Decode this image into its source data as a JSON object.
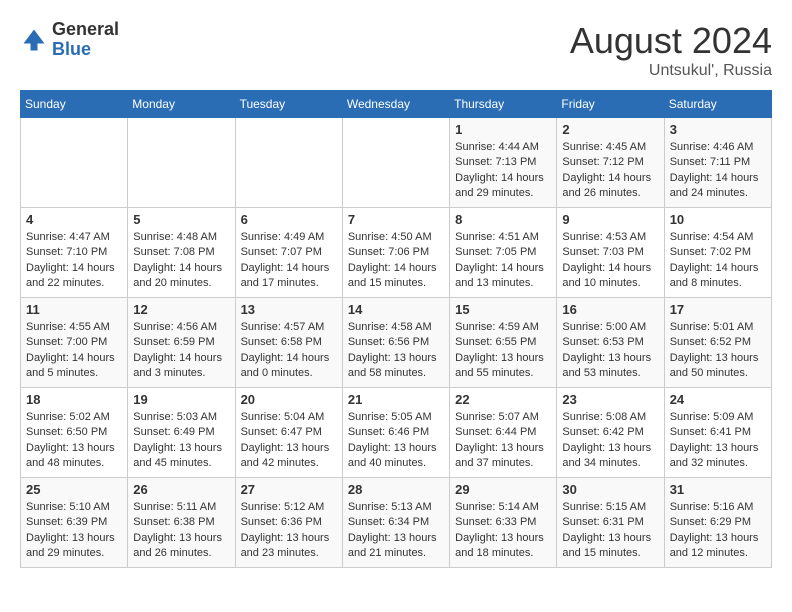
{
  "header": {
    "logo": {
      "general": "General",
      "blue": "Blue"
    },
    "title": "August 2024",
    "location": "Untsukul', Russia"
  },
  "weekdays": [
    "Sunday",
    "Monday",
    "Tuesday",
    "Wednesday",
    "Thursday",
    "Friday",
    "Saturday"
  ],
  "weeks": [
    [
      {
        "day": "",
        "info": ""
      },
      {
        "day": "",
        "info": ""
      },
      {
        "day": "",
        "info": ""
      },
      {
        "day": "",
        "info": ""
      },
      {
        "day": "1",
        "info": "Sunrise: 4:44 AM\nSunset: 7:13 PM\nDaylight: 14 hours\nand 29 minutes."
      },
      {
        "day": "2",
        "info": "Sunrise: 4:45 AM\nSunset: 7:12 PM\nDaylight: 14 hours\nand 26 minutes."
      },
      {
        "day": "3",
        "info": "Sunrise: 4:46 AM\nSunset: 7:11 PM\nDaylight: 14 hours\nand 24 minutes."
      }
    ],
    [
      {
        "day": "4",
        "info": "Sunrise: 4:47 AM\nSunset: 7:10 PM\nDaylight: 14 hours\nand 22 minutes."
      },
      {
        "day": "5",
        "info": "Sunrise: 4:48 AM\nSunset: 7:08 PM\nDaylight: 14 hours\nand 20 minutes."
      },
      {
        "day": "6",
        "info": "Sunrise: 4:49 AM\nSunset: 7:07 PM\nDaylight: 14 hours\nand 17 minutes."
      },
      {
        "day": "7",
        "info": "Sunrise: 4:50 AM\nSunset: 7:06 PM\nDaylight: 14 hours\nand 15 minutes."
      },
      {
        "day": "8",
        "info": "Sunrise: 4:51 AM\nSunset: 7:05 PM\nDaylight: 14 hours\nand 13 minutes."
      },
      {
        "day": "9",
        "info": "Sunrise: 4:53 AM\nSunset: 7:03 PM\nDaylight: 14 hours\nand 10 minutes."
      },
      {
        "day": "10",
        "info": "Sunrise: 4:54 AM\nSunset: 7:02 PM\nDaylight: 14 hours\nand 8 minutes."
      }
    ],
    [
      {
        "day": "11",
        "info": "Sunrise: 4:55 AM\nSunset: 7:00 PM\nDaylight: 14 hours\nand 5 minutes."
      },
      {
        "day": "12",
        "info": "Sunrise: 4:56 AM\nSunset: 6:59 PM\nDaylight: 14 hours\nand 3 minutes."
      },
      {
        "day": "13",
        "info": "Sunrise: 4:57 AM\nSunset: 6:58 PM\nDaylight: 14 hours\nand 0 minutes."
      },
      {
        "day": "14",
        "info": "Sunrise: 4:58 AM\nSunset: 6:56 PM\nDaylight: 13 hours\nand 58 minutes."
      },
      {
        "day": "15",
        "info": "Sunrise: 4:59 AM\nSunset: 6:55 PM\nDaylight: 13 hours\nand 55 minutes."
      },
      {
        "day": "16",
        "info": "Sunrise: 5:00 AM\nSunset: 6:53 PM\nDaylight: 13 hours\nand 53 minutes."
      },
      {
        "day": "17",
        "info": "Sunrise: 5:01 AM\nSunset: 6:52 PM\nDaylight: 13 hours\nand 50 minutes."
      }
    ],
    [
      {
        "day": "18",
        "info": "Sunrise: 5:02 AM\nSunset: 6:50 PM\nDaylight: 13 hours\nand 48 minutes."
      },
      {
        "day": "19",
        "info": "Sunrise: 5:03 AM\nSunset: 6:49 PM\nDaylight: 13 hours\nand 45 minutes."
      },
      {
        "day": "20",
        "info": "Sunrise: 5:04 AM\nSunset: 6:47 PM\nDaylight: 13 hours\nand 42 minutes."
      },
      {
        "day": "21",
        "info": "Sunrise: 5:05 AM\nSunset: 6:46 PM\nDaylight: 13 hours\nand 40 minutes."
      },
      {
        "day": "22",
        "info": "Sunrise: 5:07 AM\nSunset: 6:44 PM\nDaylight: 13 hours\nand 37 minutes."
      },
      {
        "day": "23",
        "info": "Sunrise: 5:08 AM\nSunset: 6:42 PM\nDaylight: 13 hours\nand 34 minutes."
      },
      {
        "day": "24",
        "info": "Sunrise: 5:09 AM\nSunset: 6:41 PM\nDaylight: 13 hours\nand 32 minutes."
      }
    ],
    [
      {
        "day": "25",
        "info": "Sunrise: 5:10 AM\nSunset: 6:39 PM\nDaylight: 13 hours\nand 29 minutes."
      },
      {
        "day": "26",
        "info": "Sunrise: 5:11 AM\nSunset: 6:38 PM\nDaylight: 13 hours\nand 26 minutes."
      },
      {
        "day": "27",
        "info": "Sunrise: 5:12 AM\nSunset: 6:36 PM\nDaylight: 13 hours\nand 23 minutes."
      },
      {
        "day": "28",
        "info": "Sunrise: 5:13 AM\nSunset: 6:34 PM\nDaylight: 13 hours\nand 21 minutes."
      },
      {
        "day": "29",
        "info": "Sunrise: 5:14 AM\nSunset: 6:33 PM\nDaylight: 13 hours\nand 18 minutes."
      },
      {
        "day": "30",
        "info": "Sunrise: 5:15 AM\nSunset: 6:31 PM\nDaylight: 13 hours\nand 15 minutes."
      },
      {
        "day": "31",
        "info": "Sunrise: 5:16 AM\nSunset: 6:29 PM\nDaylight: 13 hours\nand 12 minutes."
      }
    ]
  ]
}
